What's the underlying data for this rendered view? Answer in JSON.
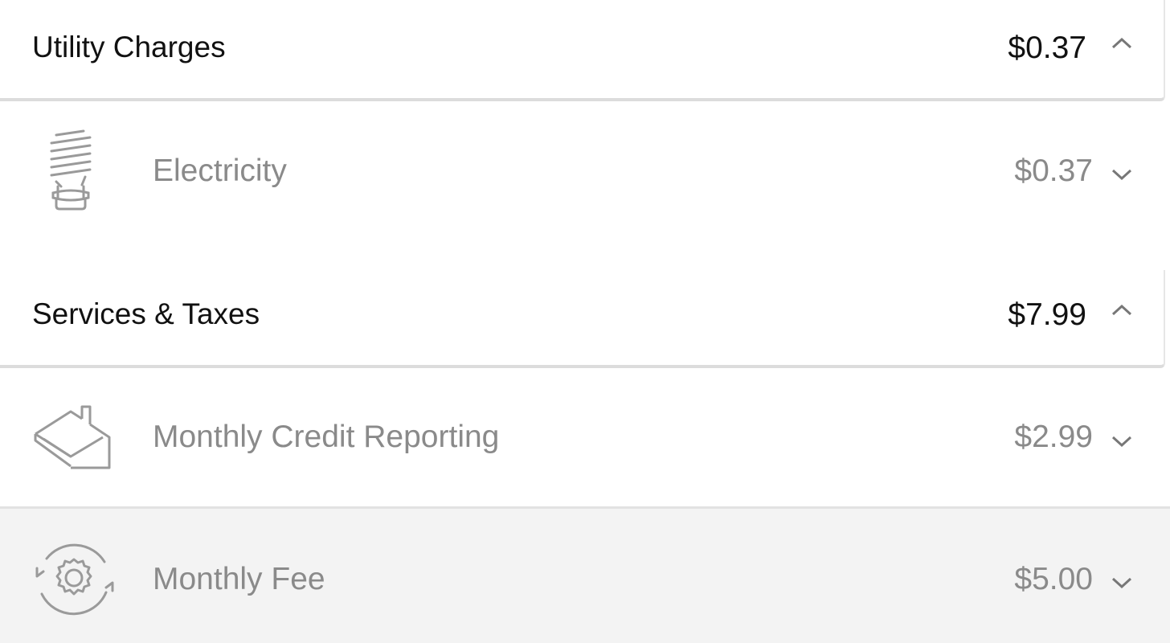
{
  "sections": [
    {
      "title": "Utility Charges",
      "amount": "$0.37",
      "expanded": true,
      "items": [
        {
          "label": "Electricity",
          "amount": "$0.37",
          "icon": "lightbulb-icon"
        }
      ]
    },
    {
      "title": "Services & Taxes",
      "amount": "$7.99",
      "expanded": true,
      "items": [
        {
          "label": "Monthly Credit Reporting",
          "amount": "$2.99",
          "icon": "house-envelope-icon"
        },
        {
          "label": "Monthly Fee",
          "amount": "$5.00",
          "icon": "gear-cycle-icon"
        }
      ]
    }
  ],
  "colors": {
    "header_text": "#111111",
    "item_text": "#8a8a8a",
    "icon_stroke": "#9a9a9a",
    "highlight_row_bg": "#f3f3f3",
    "divider": "#e2e2e2"
  }
}
